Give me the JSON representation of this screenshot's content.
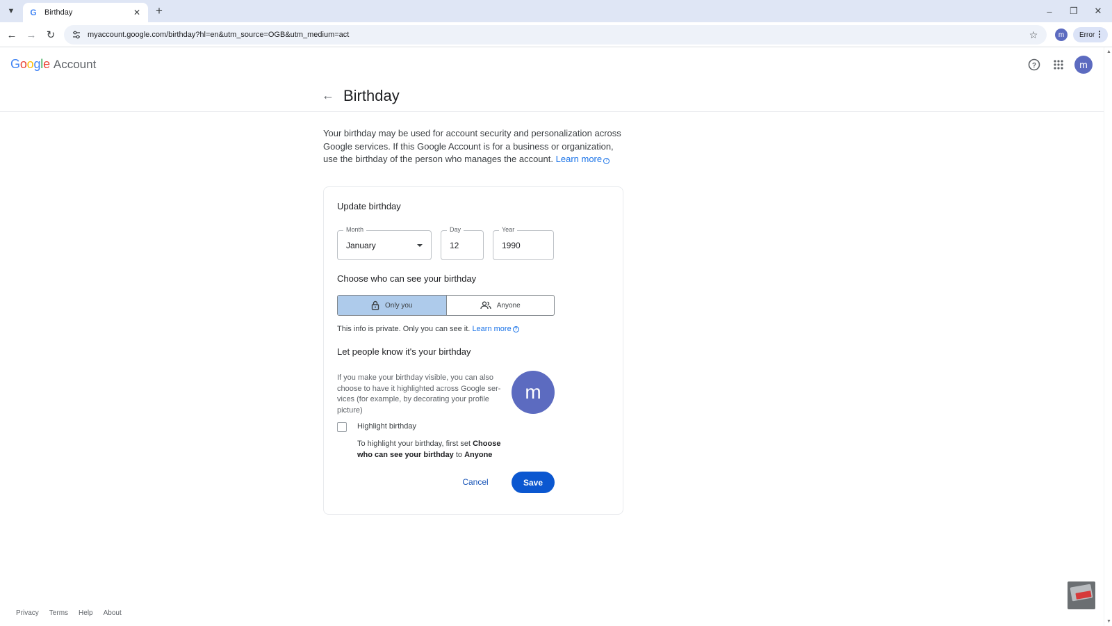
{
  "browser": {
    "tab_title": "Birthday",
    "url": "myaccount.google.com/birthday?hl=en&utm_source=OGB&utm_medium=act",
    "profile_initial": "m",
    "error_label": "Error"
  },
  "header": {
    "logo_google": "Google",
    "logo_account": "Account",
    "avatar_initial": "m"
  },
  "page": {
    "title": "Birthday",
    "intro": "Your birthday may be used for account security and personalization across Google services. If this Google Account is for a business or organization, use the birthday of the person who manages the account.",
    "learn_more": "Learn more"
  },
  "card": {
    "title": "Update birthday",
    "month": {
      "label": "Month",
      "value": "January"
    },
    "day": {
      "label": "Day",
      "value": "12"
    },
    "year": {
      "label": "Year",
      "value": "1990"
    },
    "visibility_heading": "Choose who can see your birthday",
    "visibility_options": [
      {
        "label": "Only you",
        "selected": true
      },
      {
        "label": "Anyone",
        "selected": false
      }
    ],
    "private_note": "This info is private. Only you can see it.",
    "private_learn_more": "Learn more",
    "highlight_heading": "Let people know it's your birthday",
    "highlight_explain": "If you make your birthday visible, you can also choose to have it highlighted across Google ser-vices (for example, by decorating your profile picture)",
    "avatar_initial": "m",
    "highlight_checkbox_label": "Highlight birthday",
    "highlight_checked": false,
    "highlight_help_prefix": "To highlight your birthday, first set",
    "highlight_help_bold1": "Choose who can see your birthday",
    "highlight_help_mid": "to",
    "highlight_help_bold2": "Anyone",
    "cancel_label": "Cancel",
    "save_label": "Save"
  },
  "footer": {
    "links": [
      "Privacy",
      "Terms",
      "Help",
      "About"
    ]
  },
  "colors": {
    "primary_blue": "#0b57d0",
    "link_blue": "#1a73e8",
    "avatar": "#5c6bc0",
    "selected_segment": "#aecbeb"
  }
}
